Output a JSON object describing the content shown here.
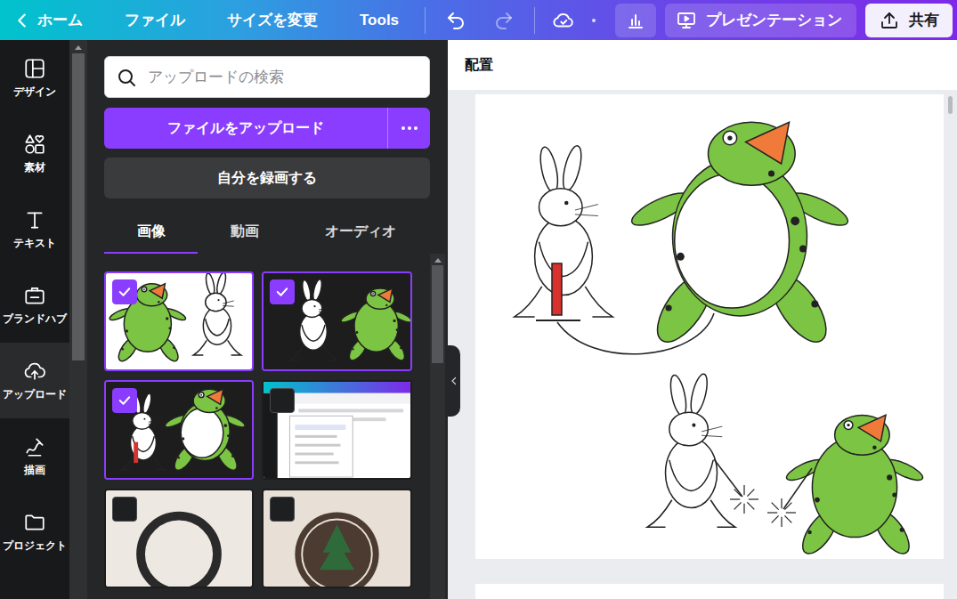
{
  "topbar": {
    "home": {
      "label": "ホーム"
    },
    "menus": [
      {
        "label": "ファイル"
      },
      {
        "label": "サイズを変更"
      },
      {
        "label": "Tools"
      }
    ],
    "history": [
      {
        "kind": "undo",
        "disabled": false
      },
      {
        "kind": "redo",
        "disabled": true
      }
    ],
    "present": {
      "label": "プレゼンテーション"
    },
    "share": {
      "label": "共有"
    }
  },
  "sidebar": {
    "items": [
      {
        "label": "デザイン",
        "selected": false
      },
      {
        "label": "素材",
        "selected": false
      },
      {
        "label": "テキスト",
        "selected": false
      },
      {
        "label": "ブランドハブ",
        "selected": false
      },
      {
        "label": "アップロード",
        "selected": true
      },
      {
        "label": "描画",
        "selected": false
      },
      {
        "label": "プロジェクト",
        "selected": false
      }
    ]
  },
  "panel": {
    "search": {
      "placeholder": "アップロードの検索"
    },
    "upload_button": {
      "label": "ファイルをアップロード"
    },
    "record_button": {
      "label": "自分を録画する"
    },
    "tabs": [
      {
        "label": "画像",
        "selected": true
      },
      {
        "label": "動画",
        "selected": false
      },
      {
        "label": "オーディオ",
        "selected": false
      }
    ],
    "thumbnails": [
      {
        "kind": "kick",
        "selected": true
      },
      {
        "kind": "duo",
        "selected": true
      },
      {
        "kind": "balloon",
        "selected": true
      },
      {
        "kind": "screenshot",
        "selected": false
      },
      {
        "kind": "ring",
        "selected": false
      },
      {
        "kind": "tree",
        "selected": false
      }
    ]
  },
  "canvas": {
    "toolbar": {
      "label": "配置"
    }
  }
}
